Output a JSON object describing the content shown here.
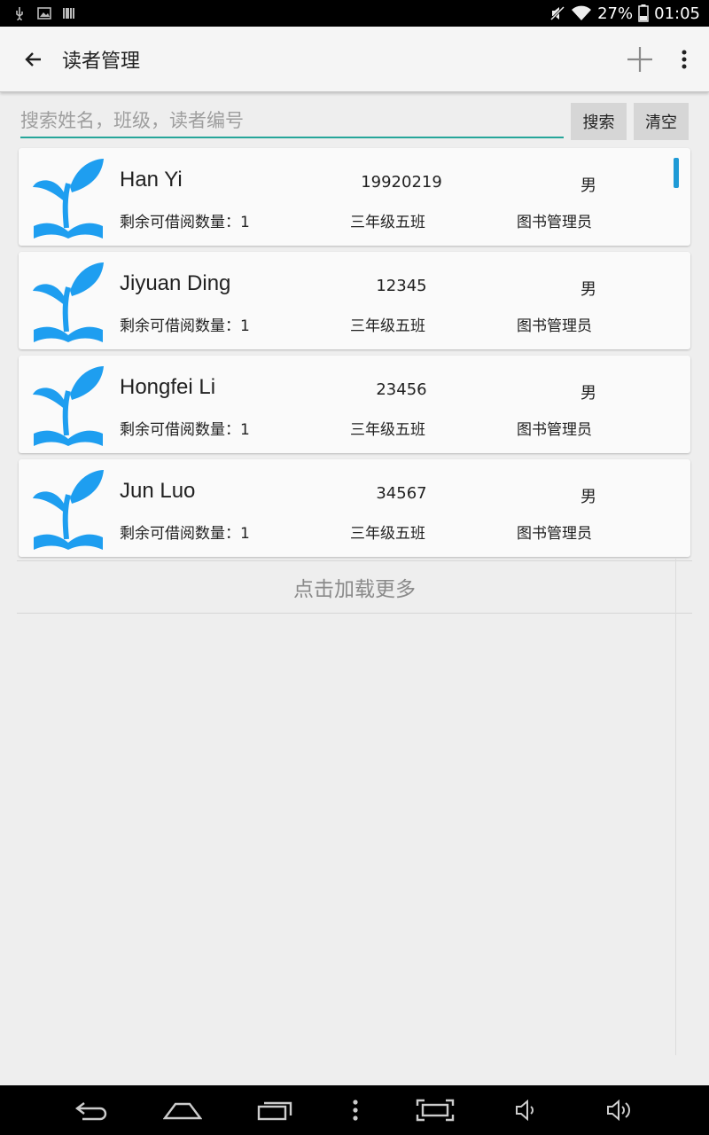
{
  "status_bar": {
    "battery": "27%",
    "time": "01:05",
    "icons": [
      "usb-icon",
      "image-icon",
      "barcode-icon",
      "mute-icon",
      "wifi-icon",
      "battery-icon"
    ]
  },
  "app_bar": {
    "title": "读者管理",
    "icons": [
      "back-arrow-icon",
      "add-icon",
      "more-vert-icon"
    ]
  },
  "search": {
    "placeholder": "搜索姓名，班级，读者编号",
    "value": "",
    "search_label": "搜索",
    "clear_label": "清空"
  },
  "readers": [
    {
      "name": "Han Yi",
      "id": "19920219",
      "gender": "男",
      "remaining": "剩余可借阅数量：1",
      "class": "三年级五班",
      "role": "图书管理员"
    },
    {
      "name": "Jiyuan Ding",
      "id": "12345",
      "gender": "男",
      "remaining": "剩余可借阅数量：1",
      "class": "三年级五班",
      "role": "图书管理员"
    },
    {
      "name": "Hongfei Li",
      "id": "23456",
      "gender": "男",
      "remaining": "剩余可借阅数量：1",
      "class": "三年级五班",
      "role": "图书管理员"
    },
    {
      "name": "Jun Luo",
      "id": "34567",
      "gender": "男",
      "remaining": "剩余可借阅数量：1",
      "class": "三年级五班",
      "role": "图书管理员"
    }
  ],
  "load_more": "点击加载更多",
  "colors": {
    "accent": "#26a69a",
    "logo_blue": "#1e9ef0",
    "scroll_indicator": "#1e9ad6"
  },
  "nav_bar": {
    "icons": [
      "back-icon",
      "home-icon",
      "recents-icon",
      "menu-dots-icon",
      "screenshot-icon",
      "volume-down-icon",
      "volume-up-icon"
    ]
  }
}
